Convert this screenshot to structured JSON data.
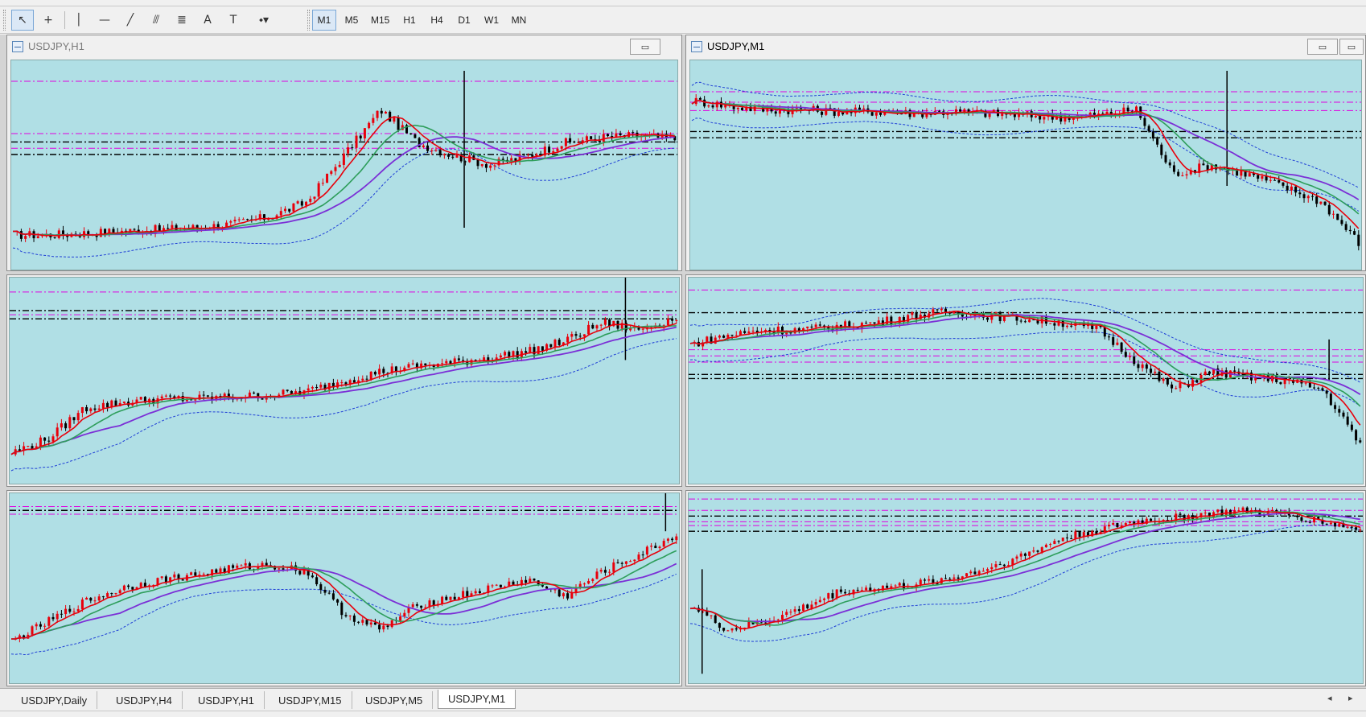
{
  "toolbar": {
    "tools": [
      {
        "name": "cursor-icon",
        "glyph": "↖",
        "active": true
      },
      {
        "name": "crosshair-icon",
        "glyph": "+"
      },
      {
        "name": "vertical-line-icon",
        "glyph": "│"
      },
      {
        "name": "horizontal-line-icon",
        "glyph": "—"
      },
      {
        "name": "trendline-icon",
        "glyph": "╱"
      },
      {
        "name": "equidistant-channel-icon",
        "glyph": "⫻"
      },
      {
        "name": "fibonacci-icon",
        "glyph": "≣"
      },
      {
        "name": "text-icon",
        "glyph": "A"
      },
      {
        "name": "text-label-icon",
        "glyph": "T"
      },
      {
        "name": "shapes-dropdown-icon",
        "glyph": "⬩▾"
      }
    ],
    "timeframes": [
      "M1",
      "M5",
      "M15",
      "H1",
      "H4",
      "D1",
      "W1",
      "MN"
    ],
    "active_timeframe": "M1"
  },
  "windows": {
    "left_top_title": "USDJPY,H1",
    "right_top_title": "USDJPY,M1",
    "minimize_glyph": "▭",
    "restore_glyph": "▭"
  },
  "tabs": {
    "items": [
      "USDJPY,Daily",
      "USDJPY,H4",
      "USDJPY,H1",
      "USDJPY,M15",
      "USDJPY,M5",
      "USDJPY,M1"
    ],
    "active": "USDJPY,M1",
    "scroll_left": "◂",
    "scroll_right": "▸"
  },
  "colors": {
    "chart_bg": "#b0dfe5",
    "bull": "#e8000b",
    "bear": "#000000",
    "ma_fast": "#e8000b",
    "ma_mid": "#2e9e5b",
    "ma_slow": "#7b2fd6",
    "band": "#1f3fd6",
    "level_magenta": "#e000e0",
    "level_black": "#000000"
  },
  "charts": [
    {
      "id": "left-top",
      "profile": [
        0.12,
        0.12,
        0.13,
        0.14,
        0.15,
        0.16,
        0.18,
        0.22,
        0.3,
        0.55,
        0.8,
        0.62,
        0.55,
        0.5,
        0.55,
        0.62,
        0.65,
        0.66,
        0.64
      ],
      "levels": [
        {
          "y": 0.1,
          "c": "m"
        },
        {
          "y": 0.35,
          "c": "m"
        },
        {
          "y": 0.39,
          "c": "k"
        },
        {
          "y": 0.42,
          "c": "m"
        },
        {
          "y": 0.45,
          "c": "k"
        }
      ],
      "spikes": [
        [
          0.68,
          0.05,
          0.8
        ]
      ]
    },
    {
      "id": "right-top",
      "profile": [
        0.85,
        0.82,
        0.8,
        0.8,
        0.79,
        0.79,
        0.78,
        0.79,
        0.78,
        0.77,
        0.76,
        0.77,
        0.8,
        0.45,
        0.5,
        0.45,
        0.38,
        0.3,
        0.08
      ],
      "levels": [
        {
          "y": 0.15,
          "c": "m"
        },
        {
          "y": 0.2,
          "c": "m"
        },
        {
          "y": 0.24,
          "c": "m"
        },
        {
          "y": 0.34,
          "c": "k"
        },
        {
          "y": 0.37,
          "c": "k"
        }
      ],
      "spikes": [
        [
          0.8,
          0.05,
          0.6
        ]
      ],
      "inverted": true
    },
    {
      "id": "left-mid",
      "profile": [
        0.1,
        0.18,
        0.35,
        0.38,
        0.4,
        0.4,
        0.41,
        0.42,
        0.44,
        0.5,
        0.55,
        0.58,
        0.6,
        0.63,
        0.66,
        0.72,
        0.82,
        0.78,
        0.85
      ],
      "levels": [
        {
          "y": 0.07,
          "c": "m"
        },
        {
          "y": 0.16,
          "c": "k"
        },
        {
          "y": 0.18,
          "c": "m"
        },
        {
          "y": 0.2,
          "c": "k"
        }
      ],
      "spikes": [
        [
          0.92,
          0.0,
          0.4
        ]
      ]
    },
    {
      "id": "right-mid",
      "profile": [
        0.7,
        0.75,
        0.78,
        0.78,
        0.8,
        0.82,
        0.86,
        0.88,
        0.86,
        0.84,
        0.82,
        0.78,
        0.6,
        0.45,
        0.55,
        0.52,
        0.5,
        0.45,
        0.15
      ],
      "levels": [
        {
          "y": 0.06,
          "c": "m"
        },
        {
          "y": 0.17,
          "c": "k"
        },
        {
          "y": 0.35,
          "c": "m"
        },
        {
          "y": 0.38,
          "c": "m"
        },
        {
          "y": 0.41,
          "c": "m"
        },
        {
          "y": 0.47,
          "c": "k"
        },
        {
          "y": 0.49,
          "c": "k"
        }
      ],
      "spikes": [
        [
          0.95,
          0.3,
          0.5
        ]
      ],
      "inverted": true
    },
    {
      "id": "left-bot",
      "profile": [
        0.18,
        0.3,
        0.42,
        0.5,
        0.55,
        0.58,
        0.62,
        0.64,
        0.6,
        0.35,
        0.25,
        0.4,
        0.45,
        0.5,
        0.55,
        0.45,
        0.6,
        0.7,
        0.82
      ],
      "levels": [
        {
          "y": 0.07,
          "c": "m"
        },
        {
          "y": 0.09,
          "c": "k"
        },
        {
          "y": 0.11,
          "c": "m"
        }
      ],
      "spikes": [
        [
          0.98,
          0.0,
          0.2
        ]
      ]
    },
    {
      "id": "right-bot",
      "profile": [
        0.4,
        0.25,
        0.3,
        0.38,
        0.48,
        0.5,
        0.52,
        0.56,
        0.62,
        0.7,
        0.8,
        0.85,
        0.9,
        0.92,
        0.95,
        0.96,
        0.94,
        0.9,
        0.85
      ],
      "levels": [
        {
          "y": 0.03,
          "c": "m"
        },
        {
          "y": 0.09,
          "c": "m"
        },
        {
          "y": 0.12,
          "c": "k"
        },
        {
          "y": 0.15,
          "c": "m"
        },
        {
          "y": 0.17,
          "c": "m"
        },
        {
          "y": 0.2,
          "c": "k"
        }
      ],
      "spikes": [
        [
          0.02,
          0.4,
          0.95
        ]
      ]
    }
  ]
}
